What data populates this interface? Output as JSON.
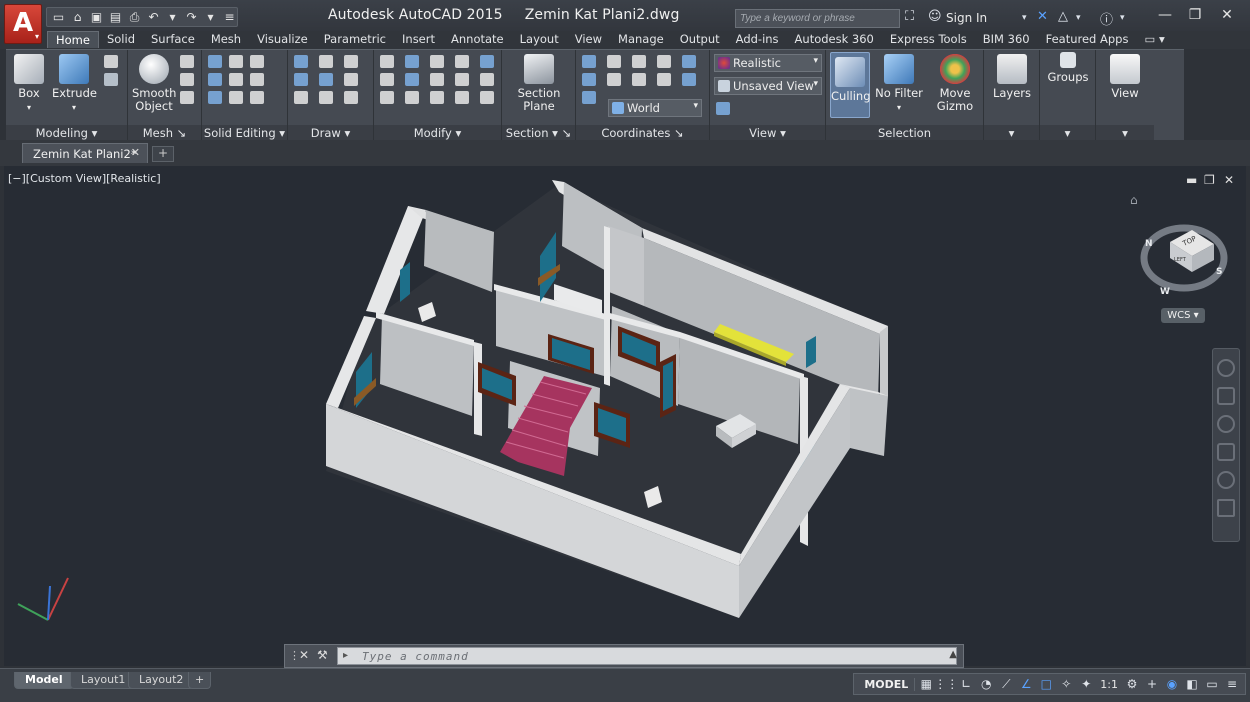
{
  "window": {
    "app_name": "Autodesk AutoCAD 2015",
    "file_name": "Zemin Kat Plani2.dwg",
    "search_placeholder": "Type a keyword or phrase",
    "sign_in": "Sign In"
  },
  "ribbon_tabs": [
    "Home",
    "Solid",
    "Surface",
    "Mesh",
    "Visualize",
    "Parametric",
    "Insert",
    "Annotate",
    "Layout",
    "View",
    "Manage",
    "Output",
    "Add-ins",
    "Autodesk 360",
    "Express Tools",
    "BIM 360",
    "Featured Apps"
  ],
  "ribbon": {
    "modeling": {
      "label": "Modeling",
      "box": "Box",
      "extrude": "Extrude"
    },
    "mesh": {
      "label": "Mesh",
      "smooth_line1": "Smooth",
      "smooth_line2": "Object"
    },
    "solid_editing": {
      "label": "Solid Editing"
    },
    "draw": {
      "label": "Draw"
    },
    "modify": {
      "label": "Modify"
    },
    "section": {
      "label": "Section",
      "plane_line1": "Section",
      "plane_line2": "Plane"
    },
    "coordinates": {
      "label": "Coordinates",
      "ucs": "World"
    },
    "view": {
      "label": "View",
      "visual_style": "Realistic",
      "saved_view": "Unsaved View"
    },
    "selection": {
      "label": "Selection",
      "culling": "Culling",
      "no_filter": "No Filter",
      "move_line1": "Move",
      "move_line2": "Gizmo"
    },
    "layers": "Layers",
    "groups": "Groups",
    "view_btn": "View"
  },
  "document_tab": "Zemin Kat Plani2*",
  "viewport": {
    "label": "[−][Custom View][Realistic]",
    "wcs": "WCS",
    "viewcube_top": "TOP",
    "viewcube_left": "LEFT",
    "compass_n": "N",
    "compass_s": "S",
    "compass_w": "W"
  },
  "command_line": {
    "placeholder": "Type a command"
  },
  "status": {
    "layouts": [
      "Model",
      "Layout1",
      "Layout2"
    ],
    "mode": "MODEL",
    "scale": "1:1"
  },
  "colors": {
    "background": "#272c34",
    "wall": "#d4d6d8",
    "stair": "#a6345f",
    "door": "#5b2414",
    "window": "#1d6f8a",
    "accent": "#5aa2ff"
  }
}
